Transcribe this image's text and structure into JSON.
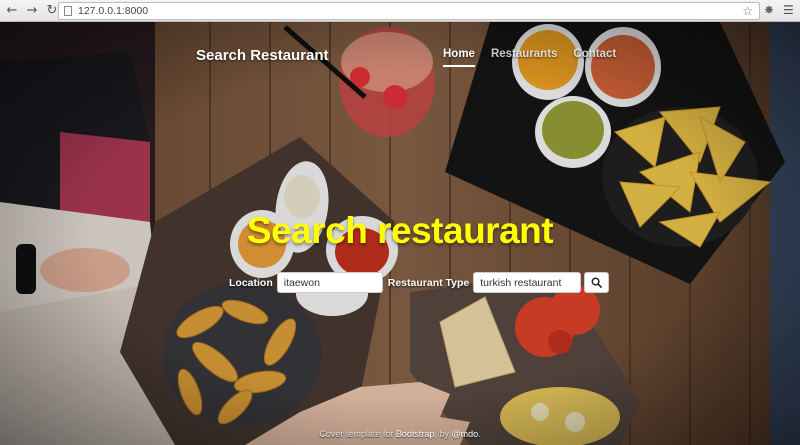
{
  "browser": {
    "url": "127.0.0.1:8000",
    "icons": [
      "back-arrow-icon",
      "forward-arrow-icon",
      "reload-icon",
      "page-icon",
      "bookmark-star-icon",
      "extension-icon",
      "menu-icon"
    ]
  },
  "site": {
    "brand": "Search Restaurant",
    "nav": [
      {
        "label": "Home",
        "active": true
      },
      {
        "label": "Restaurants",
        "active": false
      },
      {
        "label": "Contact",
        "active": false
      }
    ]
  },
  "hero": {
    "headline": "Search restaurant",
    "headline_color": "#ffff00"
  },
  "search": {
    "location_label": "Location",
    "location_value": "itaewon",
    "type_label": "Restaurant Type",
    "type_value": "turkish restaurant",
    "button_icon": "search-icon"
  },
  "footer": {
    "prefix": "Cover template for ",
    "link1": "Bootstrap",
    "middle": ", by ",
    "link2": "@mdo",
    "suffix": "."
  }
}
